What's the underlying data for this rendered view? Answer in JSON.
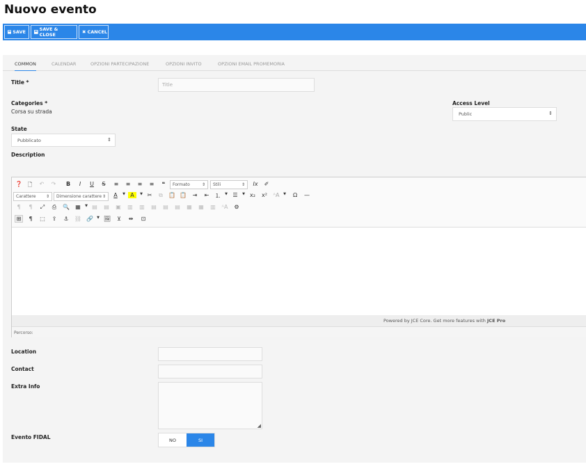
{
  "page": {
    "title": "Nuovo evento"
  },
  "toolbar": {
    "save": "SAVE",
    "save_close": "SAVE & CLOSE",
    "cancel": "CANCEL"
  },
  "tabs": [
    "COMMON",
    "CALENDAR",
    "OPZIONI PARTECIPAZIONE",
    "OPZIONI INVITO",
    "OPZIONI EMAIL PROMEMORIA"
  ],
  "form": {
    "title_label": "Title *",
    "title_placeholder": "Title",
    "categories_label": "Categories *",
    "categories_value": "Corsa su strada",
    "access_label": "Access Level",
    "access_value": "Public",
    "state_label": "State",
    "state_value": "Pubblicato",
    "description_label": "Description",
    "location_label": "Location",
    "contact_label": "Contact",
    "extra_label": "Extra Info",
    "fidal_label": "Evento FIDAL",
    "fidal_no": "NO",
    "fidal_si": "SI"
  },
  "editor": {
    "format_select": "Formato",
    "styles_select": "Stili",
    "font_select": "Carattere",
    "size_select": "Dimensione carattere",
    "powered": "Powered by JCE Core. Get more features with ",
    "pro": "JCE Pro",
    "path": "Percorso:"
  },
  "colors": {
    "accent": "#2b86e8"
  }
}
